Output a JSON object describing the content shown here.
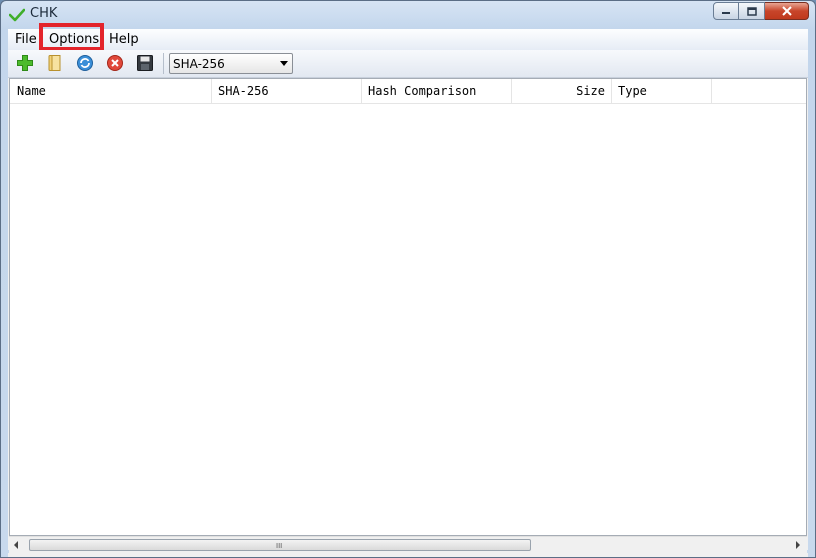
{
  "window": {
    "title": "CHK"
  },
  "menu": {
    "file": "File",
    "options": "Options",
    "help": "Help"
  },
  "toolbar": {
    "icons": [
      "add-icon",
      "folder-icon",
      "refresh-icon",
      "remove-icon",
      "save-icon"
    ],
    "hash_select_value": "SHA-256"
  },
  "list": {
    "columns": [
      "Name",
      "SHA-256",
      "Hash Comparison",
      "Size",
      "Type"
    ],
    "rows": []
  },
  "scrollbar": {
    "grip": "III"
  },
  "colors": {
    "highlight": "#e3242b",
    "close_button": "#c8452a",
    "check_icon": "#3fae2a"
  }
}
